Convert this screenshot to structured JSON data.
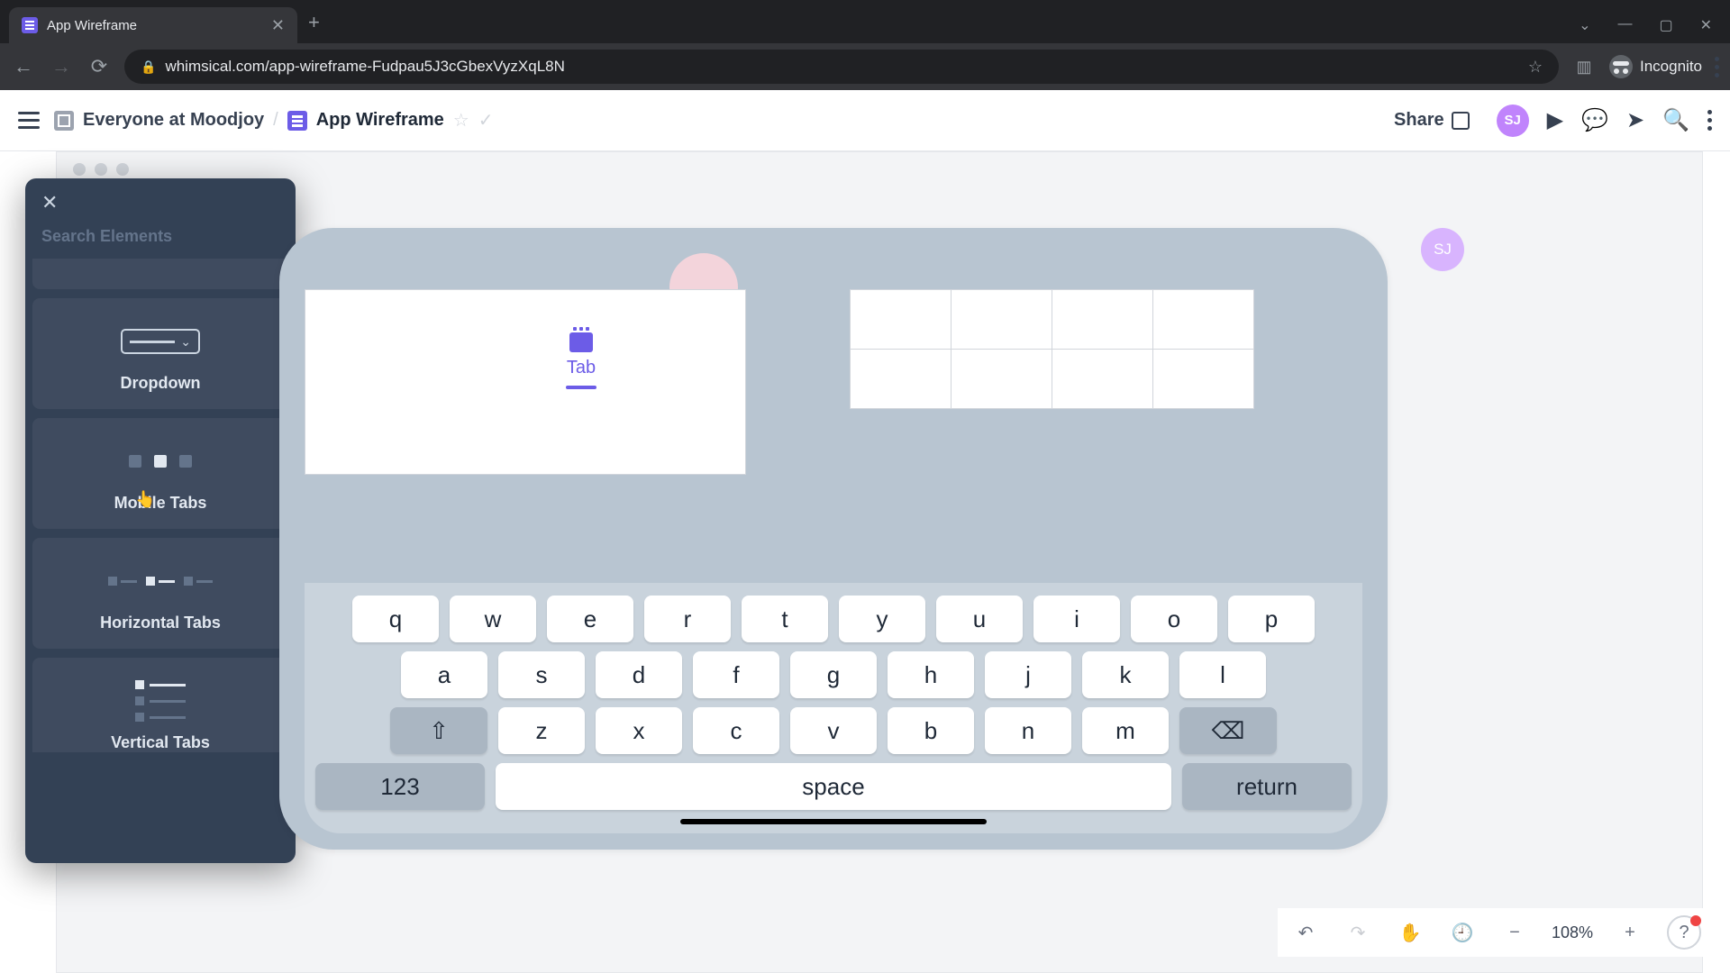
{
  "browser": {
    "tab_title": "App Wireframe",
    "url": "whimsical.com/app-wireframe-Fudpau5J3cGbexVyzXqL8N",
    "incognito_label": "Incognito"
  },
  "header": {
    "team": "Everyone at Moodjoy",
    "doc": "App Wireframe",
    "share": "Share",
    "user_initials": "SJ"
  },
  "panel": {
    "search_placeholder": "Search Elements",
    "cards": {
      "dropdown": "Dropdown",
      "mobile_tabs": "Mobile Tabs",
      "horizontal_tabs": "Horizontal Tabs",
      "vertical_tabs": "Vertical Tabs"
    }
  },
  "canvas": {
    "tab_element_label": "Tab",
    "float_avatar": "SJ"
  },
  "keyboard": {
    "row1": [
      "q",
      "w",
      "e",
      "r",
      "t",
      "y",
      "u",
      "i",
      "o",
      "p"
    ],
    "row2": [
      "a",
      "s",
      "d",
      "f",
      "g",
      "h",
      "j",
      "k",
      "l"
    ],
    "row3": [
      "z",
      "x",
      "c",
      "v",
      "b",
      "n",
      "m"
    ],
    "num": "123",
    "space": "space",
    "return": "return"
  },
  "bottombar": {
    "zoom": "108%"
  }
}
